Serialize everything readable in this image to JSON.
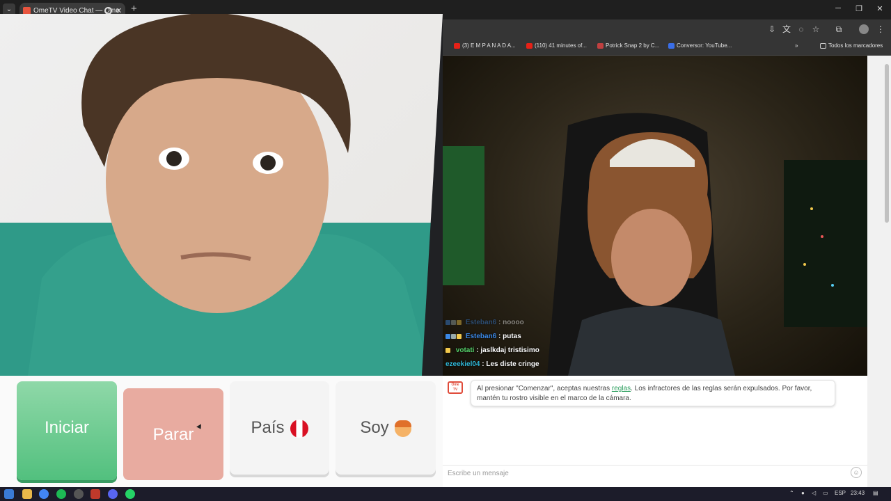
{
  "browser": {
    "tab_title": "OmeTV Video Chat — Ome",
    "tab_close": "✕",
    "new_tab": "+",
    "menu_glyph": "⌄",
    "win_min": "─",
    "win_max": "❐",
    "win_close": "✕",
    "bookmarks": [
      {
        "label": "(3) E M P A N A D A...",
        "color": "#e62117"
      },
      {
        "label": "(110) 41 minutes of...",
        "color": "#e62117"
      },
      {
        "label": "Potrick Snap 2 by C...",
        "color": "#c04040"
      },
      {
        "label": "Conversor: YouTube...",
        "color": "#3a6ee8"
      }
    ],
    "bookmarks_overflow": "»",
    "all_bookmarks": "Todos los marcadores"
  },
  "controls": {
    "start_label": "Iniciar",
    "stop_label": "Parar",
    "country_label": "País",
    "gender_label": "Soy"
  },
  "stream_chat": [
    {
      "user": "Esteban6",
      "text": ": noooo",
      "faded": true
    },
    {
      "user": "Esteban6",
      "text": ": putas",
      "faded": false
    },
    {
      "user": "votati",
      "text": ": jaslkdaj tristisimo",
      "faded": false
    },
    {
      "user": "ezeekiel04",
      "text": ": Les diste cringe",
      "faded": false
    }
  ],
  "chat": {
    "logo_text": "Ome TV",
    "notice_before": "Al presionar \"Comenzar\", aceptas nuestras ",
    "notice_link": "reglas",
    "notice_after": ". Los infractores de las reglas serán expulsados. Por favor, mantén tu rostro visible en el marco de la cámara.",
    "input_placeholder": "Escribe un mensaje",
    "emoji_glyph": "☺"
  },
  "taskbar": {
    "language": "ESP",
    "time": "23:43"
  },
  "colors": {
    "start_green": "#52c07e",
    "stop_salmon": "#e8aba0",
    "link_green": "#2a9d5c"
  }
}
